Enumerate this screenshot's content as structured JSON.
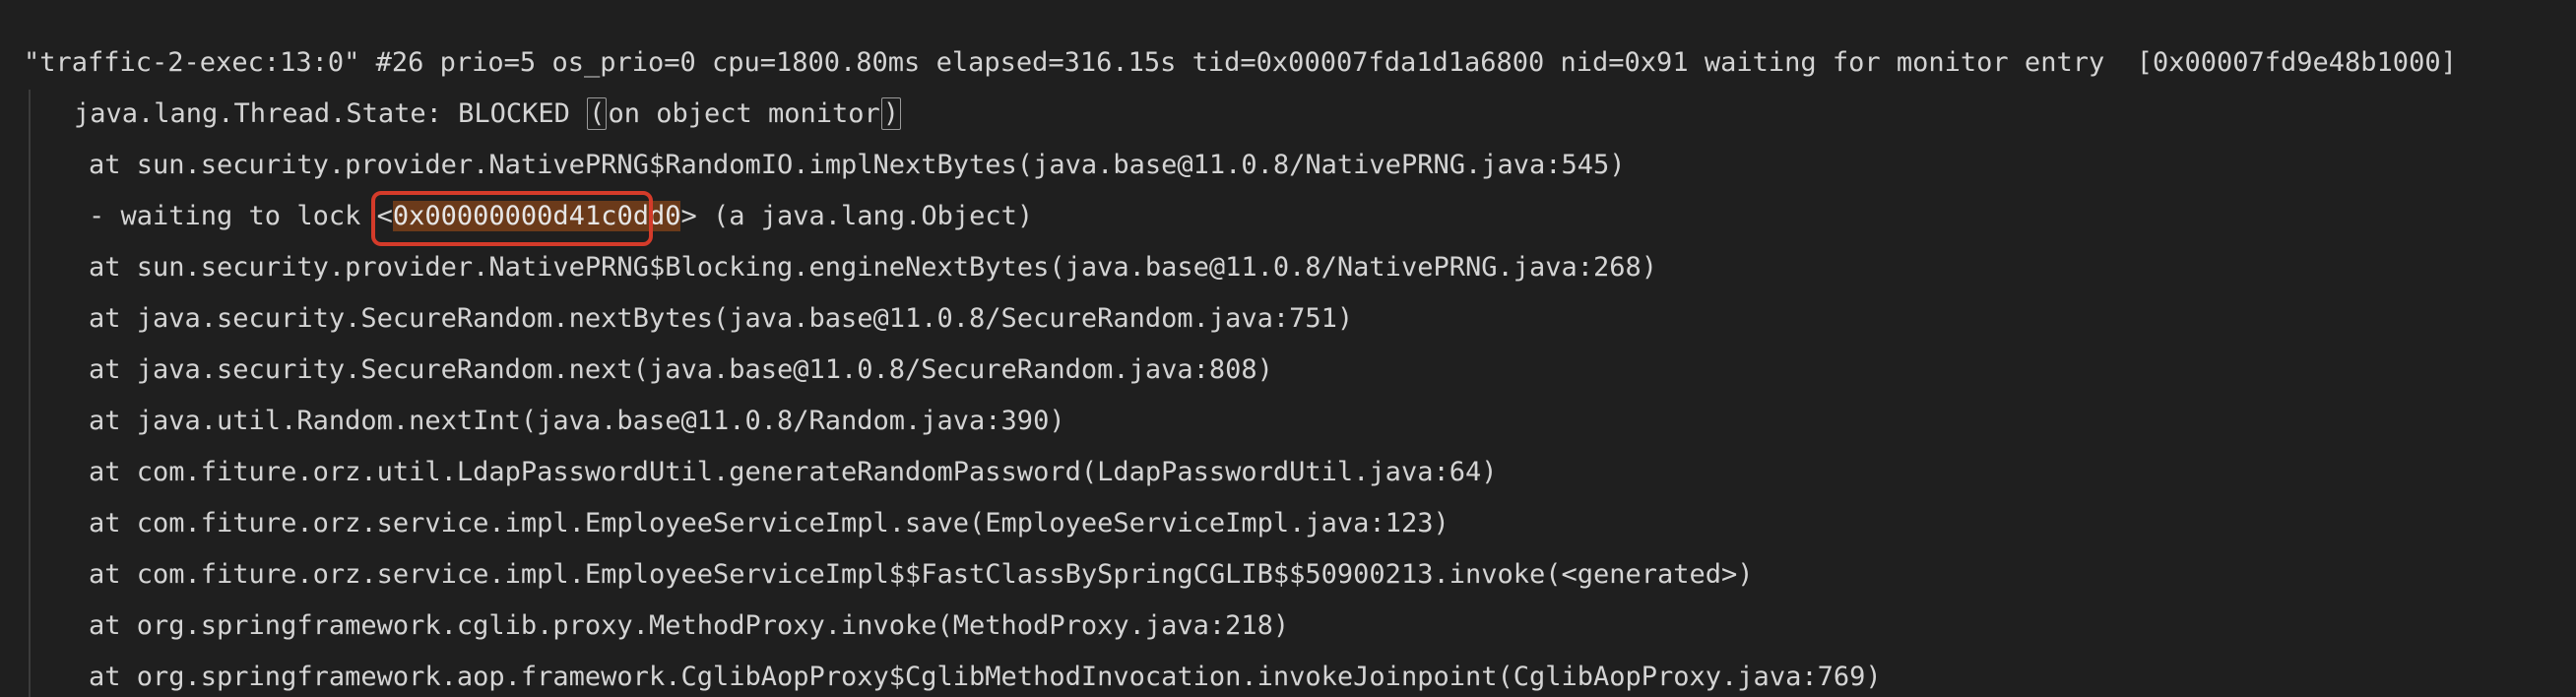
{
  "header": {
    "thread_name": "\"traffic-2-exec:13:0\"",
    "details": " #26 prio=5 os_prio=0 cpu=1800.80ms elapsed=316.15s tid=0x00007fda1d1a6800 nid=0x91 waiting for monitor entry  [0x00007fd9e48b1000]"
  },
  "state": {
    "prefix": "java.lang.Thread.State: BLOCKED ",
    "open_paren": "(",
    "text": "on object monitor",
    "close_paren": ")"
  },
  "lock": {
    "prefix": "- waiting to lock ",
    "lt": "<",
    "address": "0x00000000d41c0dd0",
    "gt": ">",
    "suffix": " (a java.lang.Object)"
  },
  "frames": [
    "at sun.security.provider.NativePRNG$RandomIO.implNextBytes(java.base@11.0.8/NativePRNG.java:545)",
    "at sun.security.provider.NativePRNG$Blocking.engineNextBytes(java.base@11.0.8/NativePRNG.java:268)",
    "at java.security.SecureRandom.nextBytes(java.base@11.0.8/SecureRandom.java:751)",
    "at java.security.SecureRandom.next(java.base@11.0.8/SecureRandom.java:808)",
    "at java.util.Random.nextInt(java.base@11.0.8/Random.java:390)",
    "at com.fiture.orz.util.LdapPasswordUtil.generateRandomPassword(LdapPasswordUtil.java:64)",
    "at com.fiture.orz.service.impl.EmployeeServiceImpl.save(EmployeeServiceImpl.java:123)",
    "at com.fiture.orz.service.impl.EmployeeServiceImpl$$FastClassBySpringCGLIB$$50900213.invoke(<generated>)",
    "at org.springframework.cglib.proxy.MethodProxy.invoke(MethodProxy.java:218)",
    "at org.springframework.aop.framework.CglibAopProxy$CglibMethodInvocation.invokeJoinpoint(CglibAopProxy.java:769)"
  ]
}
